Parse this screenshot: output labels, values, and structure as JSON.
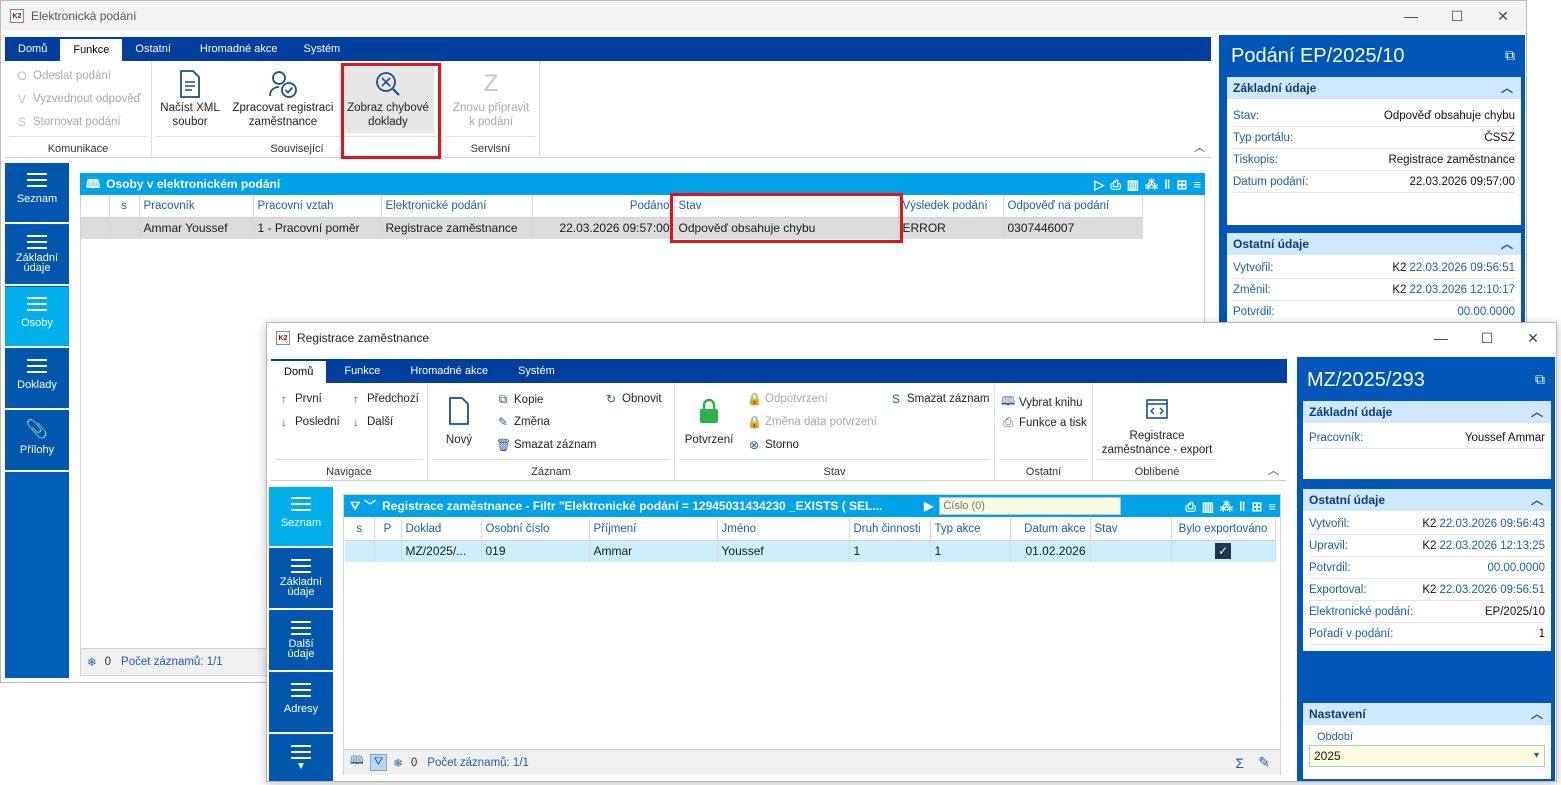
{
  "win1": {
    "title": "Elektronická podání",
    "logo": "K2",
    "tabs": [
      "Domů",
      "Funkce",
      "Ostatní",
      "Hromadné akce",
      "Systém"
    ],
    "active_tab": "Funkce",
    "ribbon": {
      "komunikace": {
        "label": "Komunikace",
        "items": [
          {
            "icon": "O",
            "label": "Odeslat podání"
          },
          {
            "icon": "V",
            "label": "Vyzvednout odpověď"
          },
          {
            "icon": "S",
            "label": "Stornovat podání"
          }
        ]
      },
      "souvisejici": {
        "label": "Související",
        "nacist": "Načíst XML soubor",
        "nacist_l1": "Načíst XML",
        "nacist_l2": "soubor",
        "zprac_l1": "Zpracovat registraci",
        "zprac_l2": "zaměstnance",
        "zobraz_l1": "Zobraz chybové",
        "zobraz_l2": "doklady"
      },
      "servisni": {
        "label": "Servisní",
        "znovu_l1": "Znovu připravit",
        "znovu_l2": "k podání"
      }
    },
    "sidebar": [
      {
        "label": "Seznam"
      },
      {
        "label": "Základní údaje",
        "l1": "Základní",
        "l2": "údaje"
      },
      {
        "label": "Osoby"
      },
      {
        "label": "Doklady"
      },
      {
        "label": "Přílohy"
      }
    ],
    "grid": {
      "title": "Osoby v elektronickém podání",
      "columns": [
        "s",
        "Pracovník",
        "Pracovní vztah",
        "Elektronické podání",
        "Podáno",
        "Stav",
        "Výsledek podání",
        "Odpověď na podání"
      ],
      "rows": [
        [
          "",
          "Ammar Youssef",
          "1 - Pracovní poměr",
          "Registrace zaměstnance",
          "22.03.2026 09:57:00",
          "Odpověď obsahuje chybu",
          "ERROR",
          "0307446007"
        ]
      ],
      "status_count": "0",
      "status_text": "Počet záznamů: 1/1"
    },
    "panel": {
      "title": "Podání EP/2025/10",
      "zakladni": {
        "head": "Základní údaje",
        "rows": [
          {
            "k": "Stav:",
            "v": "Odpověď obsahuje chybu"
          },
          {
            "k": "Typ portálu:",
            "v": "ČSSZ"
          },
          {
            "k": "Tiskopis:",
            "v": "Registrace zaměstnance"
          },
          {
            "k": "Datum podání:",
            "v": "22.03.2026 09:57:00"
          }
        ]
      },
      "ostatni": {
        "head": "Ostatní údaje",
        "rows": [
          {
            "k": "Vytvořil:",
            "p": "K2",
            "v": "22.03.2026 09:56:51"
          },
          {
            "k": "Změnil:",
            "p": "K2",
            "v": "22.03.2026 12:10:17"
          },
          {
            "k": "Potvrdil:",
            "p": "",
            "v": "00.00.0000"
          }
        ]
      }
    }
  },
  "win2": {
    "title": "Registrace zaměstnance",
    "logo": "K2",
    "tabs": [
      "Domů",
      "Funkce",
      "Hromadné akce",
      "Systém"
    ],
    "active_tab": "Domů",
    "ribbon": {
      "navigace": {
        "label": "Navigace",
        "prvni": "První",
        "predchozi": "Předchozí",
        "posledni": "Poslední",
        "dalsi": "Další"
      },
      "zaznam": {
        "label": "Záznam",
        "novy": "Nový",
        "kopie": "Kopie",
        "zmena": "Změna",
        "smazat": "Smazat záznam",
        "obnovit": "Obnovit"
      },
      "stav": {
        "label": "Stav",
        "potvrzeni": "Potvrzení",
        "odpotvrzeni": "Odpotvrzení",
        "zmena_data": "Změna data potvrzení",
        "storno": "Storno",
        "smazat": "Smazat záznam"
      },
      "ostatni": {
        "label": "Ostatní",
        "vybrat": "Vybrat knihu",
        "funkce": "Funkce a tisk"
      },
      "oblibene": {
        "label": "Oblíbené",
        "reg_l1": "Registrace",
        "reg_l2": "zaměstnance - export"
      }
    },
    "sidebar": [
      {
        "label": "Seznam"
      },
      {
        "l1": "Základní",
        "l2": "údaje"
      },
      {
        "l1": "Další",
        "l2": "údaje"
      },
      {
        "label": "Adresy"
      },
      {
        "label": ""
      }
    ],
    "grid": {
      "title": "Registrace zaměstnance - Filtr \"Elektronické podání = 12945031434230 _EXISTS ( SEL...",
      "search_placeholder": "Číslo (0)",
      "columns": [
        "s",
        "P",
        "Doklad",
        "Osobní číslo",
        "Příjmení",
        "Jméno",
        "Druh činnosti",
        "Typ akce",
        "Datum akce",
        "Stav",
        "Bylo exportováno"
      ],
      "rows": [
        [
          "",
          "",
          "MZ/2025/...",
          "019",
          "Ammar",
          "Youssef",
          "1",
          "1",
          "01.02.2026",
          "",
          "✓"
        ]
      ],
      "status_count": "0",
      "status_text": "Počet záznamů: 1/1"
    },
    "panel": {
      "title": "MZ/2025/293",
      "zakladni": {
        "head": "Základní údaje",
        "rows": [
          {
            "k": "Pracovník:",
            "v": "Youssef Ammar"
          }
        ]
      },
      "ostatni": {
        "head": "Ostatní údaje",
        "rows": [
          {
            "k": "Vytvořil:",
            "p": "K2",
            "v": "22.03.2026 09:56:43"
          },
          {
            "k": "Upravil:",
            "p": "K2",
            "v": "22.03.2026 12:13:25"
          },
          {
            "k": "Potvrdil:",
            "p": "",
            "v": "00.00.0000"
          },
          {
            "k": "Exportoval:",
            "p": "K2",
            "v": "22.03.2026 09:56:51"
          },
          {
            "k": "Elektronické podání:",
            "p": "",
            "v": "EP/2025/10"
          },
          {
            "k": "Pořadí v podání:",
            "p": "",
            "v": "1"
          }
        ]
      },
      "nastaveni": {
        "head": "Nastavení",
        "obdobi_label": "Období",
        "obdobi_value": "2025"
      }
    }
  }
}
